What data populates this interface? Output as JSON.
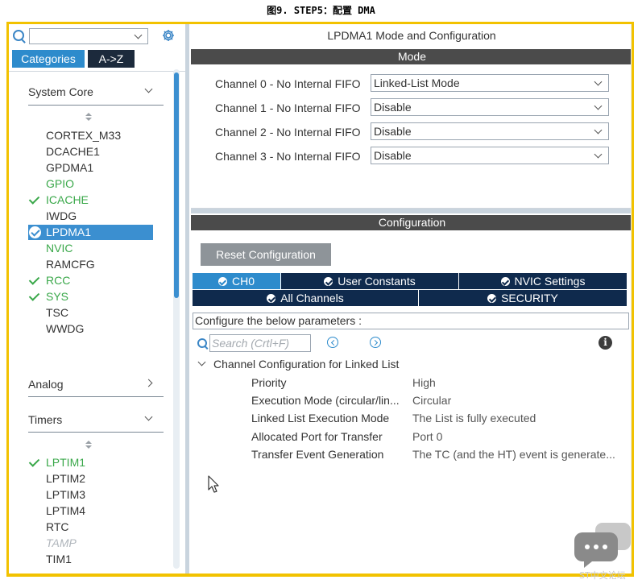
{
  "caption": "图9.        STEP5：配置 DMA",
  "left": {
    "tabs": [
      {
        "label": "Categories"
      },
      {
        "label": "A->Z"
      }
    ],
    "groups": {
      "system_core": {
        "label": "System Core",
        "items": [
          "CORTEX_M33",
          "DCACHE1",
          "GPDMA1",
          "GPIO",
          "ICACHE",
          "IWDG",
          "LPDMA1",
          "NVIC",
          "RAMCFG",
          "RCC",
          "SYS",
          "TSC",
          "WWDG"
        ]
      },
      "analog": {
        "label": "Analog"
      },
      "timers": {
        "label": "Timers",
        "items": [
          "LPTIM1",
          "LPTIM2",
          "LPTIM3",
          "LPTIM4",
          "RTC",
          "TAMP",
          "TIM1"
        ]
      }
    }
  },
  "right": {
    "title": "LPDMA1 Mode and Configuration",
    "mode_header": "Mode",
    "channels": [
      {
        "label": "Channel 0  - No Internal FIFO",
        "value": "Linked-List Mode"
      },
      {
        "label": "Channel 1  - No Internal FIFO",
        "value": "Disable"
      },
      {
        "label": "Channel 2  - No Internal FIFO",
        "value": "Disable"
      },
      {
        "label": "Channel 3  - No Internal FIFO",
        "value": "Disable"
      }
    ],
    "config_header": "Configuration",
    "reset_button": "Reset Configuration",
    "tabs_row1": [
      "CH0",
      "User Constants",
      "NVIC Settings"
    ],
    "tabs_row2": [
      "All Channels",
      "SECURITY"
    ],
    "hint": "Configure the below parameters :",
    "search_placeholder": "Search (Crtl+F)",
    "info_glyph": "i",
    "tree_group": "Channel Configuration for Linked List",
    "params": [
      {
        "name": "Priority",
        "value": "High"
      },
      {
        "name": "Execution Mode (circular/lin...",
        "value": "Circular"
      },
      {
        "name": "Linked List Execution Mode",
        "value": "The List is fully executed"
      },
      {
        "name": "Allocated Port for Transfer",
        "value": "Port 0"
      },
      {
        "name": "Transfer Event Generation",
        "value": "The TC (and the HT) event is generate..."
      }
    ]
  },
  "watermark": "ST中文论坛",
  "colors": {
    "accent": "#2d8bcc",
    "enabled_green": "#3aa84a",
    "tab_dark": "#0f2a4d",
    "frame_yellow": "#f2c200"
  }
}
